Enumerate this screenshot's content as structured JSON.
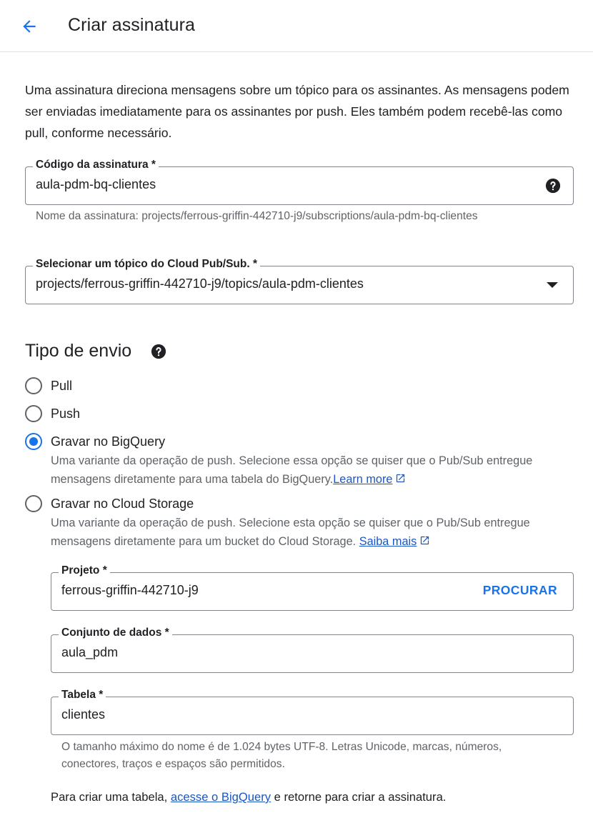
{
  "header": {
    "title": "Criar assinatura",
    "back_icon": "arrow-back-icon"
  },
  "intro": {
    "text": "Uma assinatura direciona mensagens sobre um tópico para os assinantes. As mensagens podem ser enviadas imediatamente para os assinantes por push. Eles também podem recebê-las como pull, conforme necessário."
  },
  "subscription_id": {
    "label": "Código da assinatura *",
    "value": "aula-pdm-bq-clientes",
    "hint": "Nome da assinatura: projects/ferrous-griffin-442710-j9/subscriptions/aula-pdm-bq-clientes"
  },
  "topic": {
    "label": "Selecionar um tópico do Cloud Pub/Sub. *",
    "value": "projects/ferrous-griffin-442710-j9/topics/aula-pdm-clientes"
  },
  "delivery": {
    "title": "Tipo de envio",
    "options": [
      {
        "label": "Pull",
        "checked": false
      },
      {
        "label": "Push",
        "checked": false
      },
      {
        "label": "Gravar no BigQuery",
        "checked": true,
        "description": "Uma variante da operação de push. Selecione essa opção se quiser que o Pub/Sub entregue mensagens diretamente para uma tabela do BigQuery.",
        "link": "Learn more"
      },
      {
        "label": "Gravar no Cloud Storage",
        "checked": false,
        "description": "Uma variante da operação de push. Selecione esta opção se quiser que o Pub/Sub entregue mensagens diretamente para um bucket do Cloud Storage.",
        "link": "Saiba mais"
      }
    ]
  },
  "bigquery": {
    "project": {
      "label": "Projeto *",
      "value": "ferrous-griffin-442710-j9",
      "button": "PROCURAR"
    },
    "dataset": {
      "label": "Conjunto de dados *",
      "value": "aula_pdm"
    },
    "table": {
      "label": "Tabela *",
      "value": "clientes",
      "hint": "O tamanho máximo do nome é de 1.024 bytes UTF-8. Letras Unicode, marcas, números, conectores, traços e espaços são permitidos."
    },
    "footer": {
      "before": "Para criar uma tabela, ",
      "link": "acesse o BigQuery",
      "after": " e retorne para criar a assinatura."
    }
  },
  "colors": {
    "accent": "#1a73e8",
    "link": "#1a56c4",
    "border": "#80868b",
    "secondary_text": "#5f6368"
  }
}
